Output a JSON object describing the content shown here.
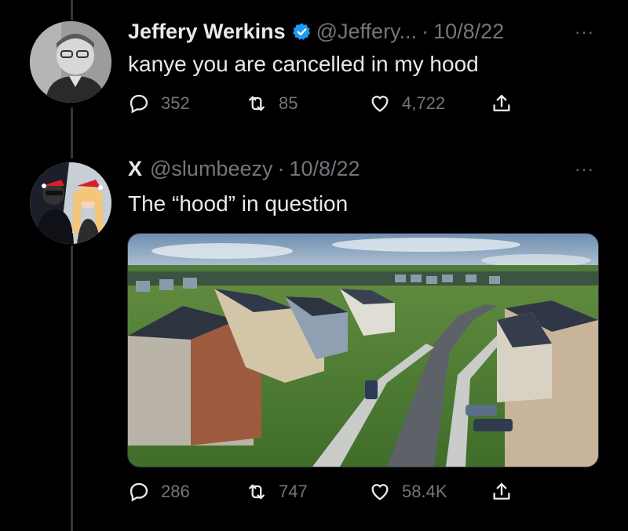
{
  "tweet1": {
    "name": "Jeffery Werkins",
    "handle": "@Jeffery...",
    "separator": "·",
    "date": "10/8/22",
    "text": "kanye you are cancelled in my hood",
    "replies": "352",
    "retweets": "85",
    "likes": "4,722"
  },
  "tweet2": {
    "name": "X",
    "handle": "@slumbeezy",
    "separator": "·",
    "date": "10/8/22",
    "text": "The “hood” in question",
    "replies": "286",
    "retweets": "747",
    "likes": "58.4K",
    "image_alt": "aerial view of suburban housing development"
  },
  "more_label": "···",
  "colors": {
    "accent": "#1d9bf0",
    "muted": "#71767b",
    "text": "#e7e9ea",
    "background": "#000000"
  },
  "icons": [
    "reply-icon",
    "retweet-icon",
    "like-icon",
    "share-icon",
    "verified-badge-icon",
    "more-icon"
  ]
}
